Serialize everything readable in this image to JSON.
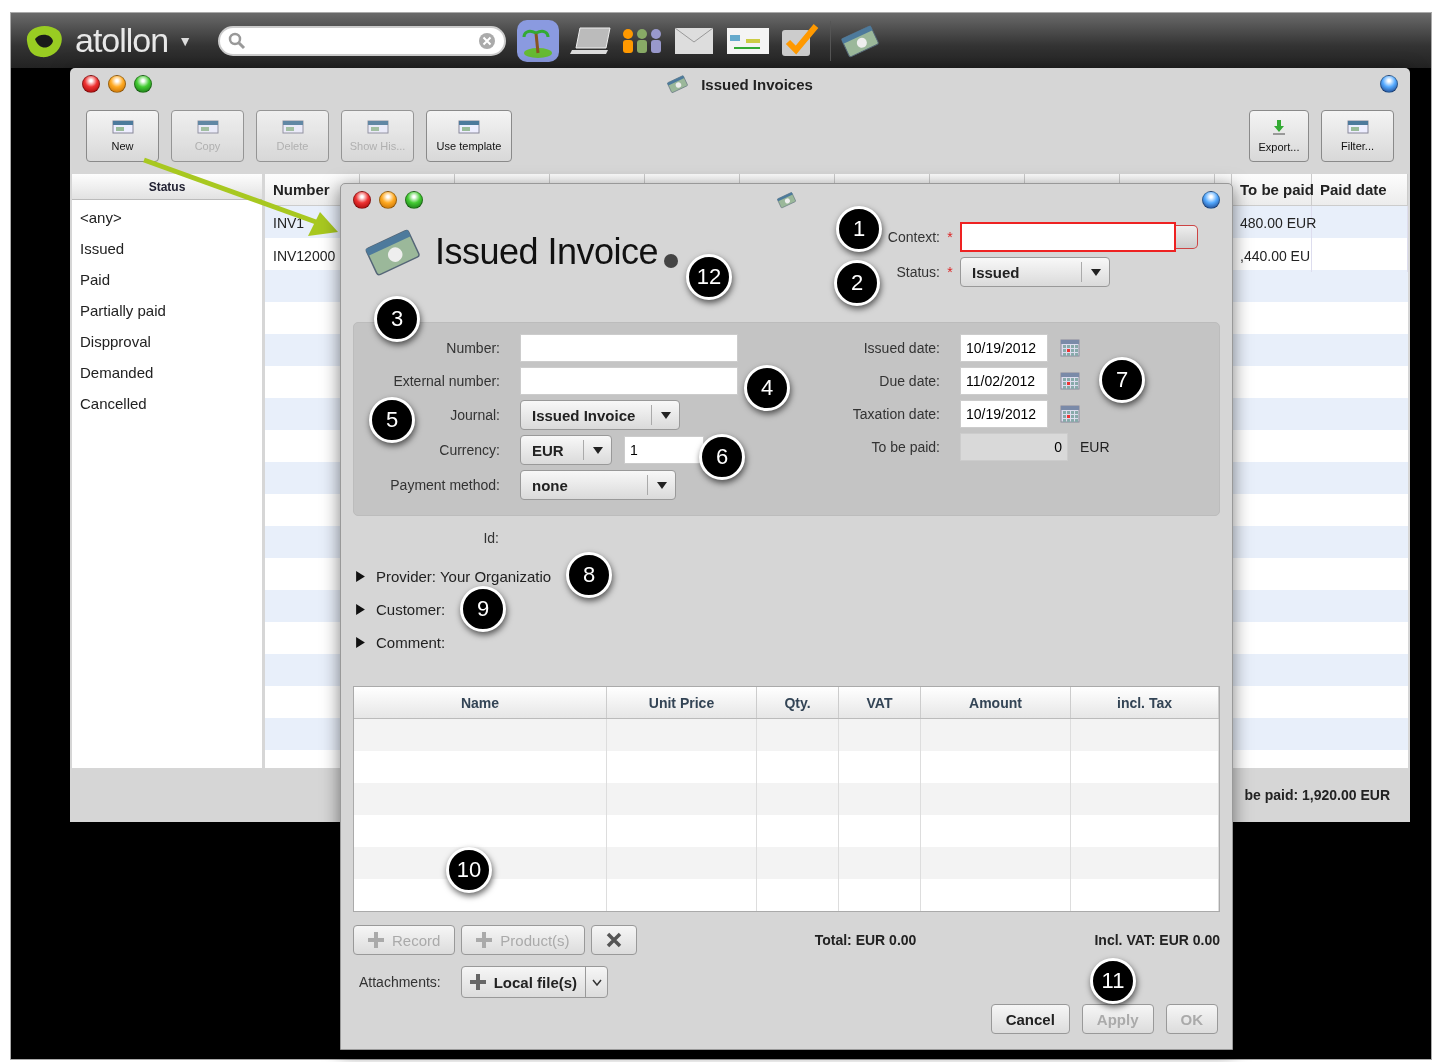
{
  "topbar": {
    "brand": "atollon",
    "brand_caret": "▼"
  },
  "window": {
    "title": "Issued Invoices",
    "toolbar": [
      {
        "label": "New",
        "disabled": false
      },
      {
        "label": "Copy",
        "disabled": true
      },
      {
        "label": "Delete",
        "disabled": true
      },
      {
        "label": "Show His...",
        "disabled": true
      },
      {
        "label": "Use template",
        "disabled": false
      }
    ],
    "toolbar_right": [
      {
        "label": "Export...",
        "kind": "export"
      },
      {
        "label": "Filter...",
        "kind": "filter"
      }
    ],
    "status_list": {
      "header": "Status",
      "items": [
        "<any>",
        "Issued",
        "Paid",
        "Partially paid",
        "Dispproval",
        "Demanded",
        "Cancelled"
      ]
    },
    "table": {
      "columns": [
        "Number",
        "To be paid",
        "Paid date"
      ],
      "rows": [
        {
          "number": "INV1",
          "to_be_paid": "480.00 EUR"
        },
        {
          "number": "INV12000",
          "to_be_paid": ",440.00 EU"
        }
      ]
    },
    "footer": "be paid: 1,920.00 EUR"
  },
  "dialog": {
    "title": "Issued Invoice",
    "required_mark": "*",
    "context": {
      "label": "Context:",
      "required": true,
      "invalid": true
    },
    "status": {
      "label": "Status:",
      "required": true,
      "value": "Issued"
    },
    "left_fields": [
      {
        "kind": "text",
        "label": "Number:"
      },
      {
        "kind": "text",
        "label": "External number:"
      },
      {
        "kind": "select",
        "label": "Journal:",
        "value": "Issued Invoice"
      },
      {
        "kind": "currency",
        "label": "Currency:",
        "value": "EUR",
        "rate": "1"
      },
      {
        "kind": "select",
        "label": "Payment method:",
        "value": "none"
      }
    ],
    "right_fields": [
      {
        "kind": "date",
        "label": "Issued date:",
        "value": "10/19/2012"
      },
      {
        "kind": "date",
        "label": "Due date:",
        "value": "11/02/2012"
      },
      {
        "kind": "date",
        "label": "Taxation date:",
        "value": "10/19/2012"
      },
      {
        "kind": "amount",
        "label": "To be paid:",
        "value": "0",
        "unit": "EUR"
      }
    ],
    "id_label": "Id:",
    "sections": [
      {
        "label": "Provider: Your Organizatio",
        "expanded": false
      },
      {
        "label": "Customer:",
        "expanded": false
      },
      {
        "label": "Comment:",
        "expanded": false
      }
    ],
    "items_table": {
      "columns": [
        "Name",
        "Unit Price",
        "Qty.",
        "VAT",
        "Amount",
        "incl. Tax"
      ]
    },
    "item_buttons": [
      {
        "label": "Record",
        "kind": "add",
        "disabled": true
      },
      {
        "label": "Product(s)",
        "kind": "add",
        "disabled": true
      },
      {
        "kind": "remove",
        "disabled": false
      }
    ],
    "total": "Total: EUR 0.00",
    "incl_vat": "Incl. VAT: EUR 0.00",
    "attachments": {
      "label": "Attachments:",
      "button": "Local file(s)"
    },
    "buttons": [
      {
        "label": "Cancel",
        "disabled": false
      },
      {
        "label": "Apply",
        "disabled": true
      },
      {
        "label": "OK",
        "disabled": true
      }
    ]
  },
  "callouts": [
    "1",
    "2",
    "3",
    "4",
    "5",
    "6",
    "7",
    "8",
    "9",
    "10",
    "11",
    "12"
  ]
}
